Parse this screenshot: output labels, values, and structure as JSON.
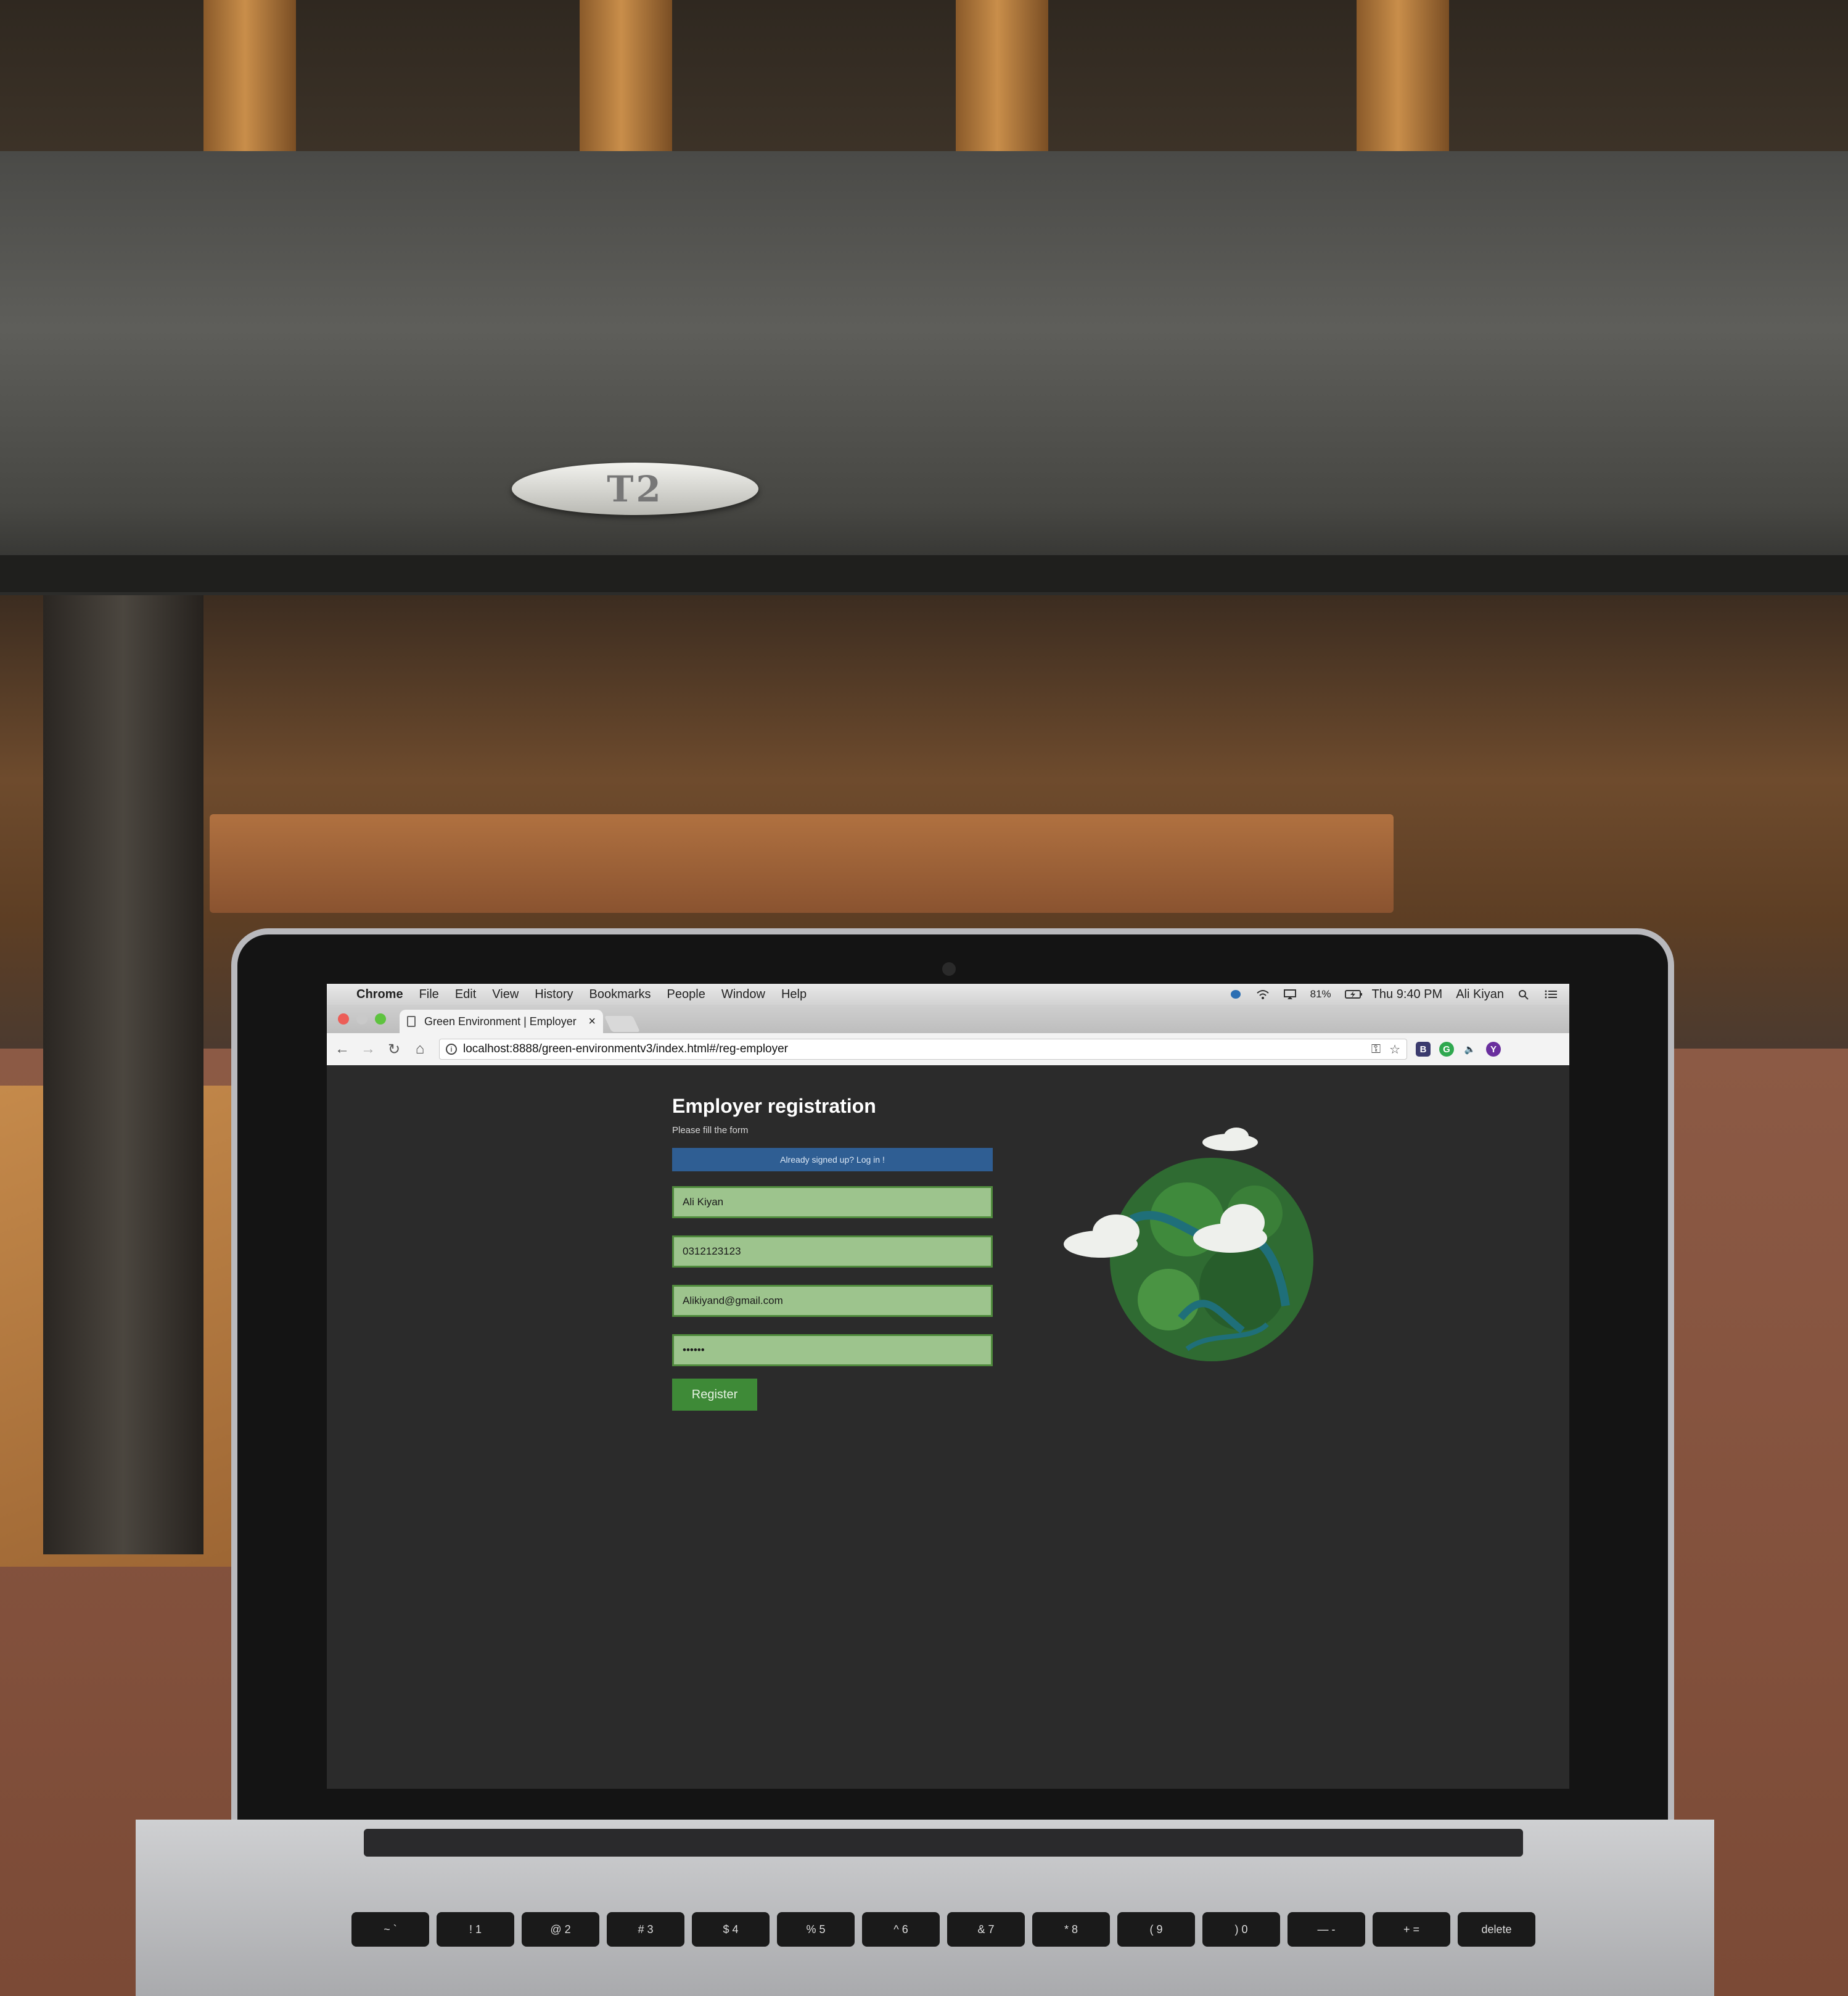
{
  "scene": {
    "plaque_text": "T2"
  },
  "menubar": {
    "app": "Chrome",
    "items": [
      "File",
      "Edit",
      "View",
      "History",
      "Bookmarks",
      "People",
      "Window",
      "Help"
    ],
    "battery": "81%",
    "clock": "Thu 9:40 PM",
    "user": "Ali Kiyan"
  },
  "browser": {
    "tab_title": "Green Environment | Employer",
    "url_host": "localhost",
    "url": "localhost:8888/green-environmentv3/index.html#/reg-employer",
    "extensions": [
      "B",
      "G",
      "Y"
    ]
  },
  "form": {
    "title": "Employer registration",
    "subtitle": "Please fill the form",
    "signin_label": "Already signed up? Log in !",
    "name_value": "Ali Kiyan",
    "phone_value": "0312123123",
    "email_value": "Alikiyand@gmail.com",
    "password_value": "••••••",
    "register_label": "Register"
  },
  "keyboard": {
    "row1": [
      "~ `",
      "! 1",
      "@ 2",
      "# 3",
      "$ 4",
      "% 5",
      "^ 6",
      "& 7",
      "* 8",
      "( 9",
      ") 0",
      "— -",
      "+ =",
      "delete"
    ]
  },
  "colors": {
    "page_bg": "#2b2b2b",
    "signin_bg": "#2f5e93",
    "field_bg": "#9dc48d",
    "field_border": "#4f8a3c",
    "register_bg": "#3e8a37"
  }
}
